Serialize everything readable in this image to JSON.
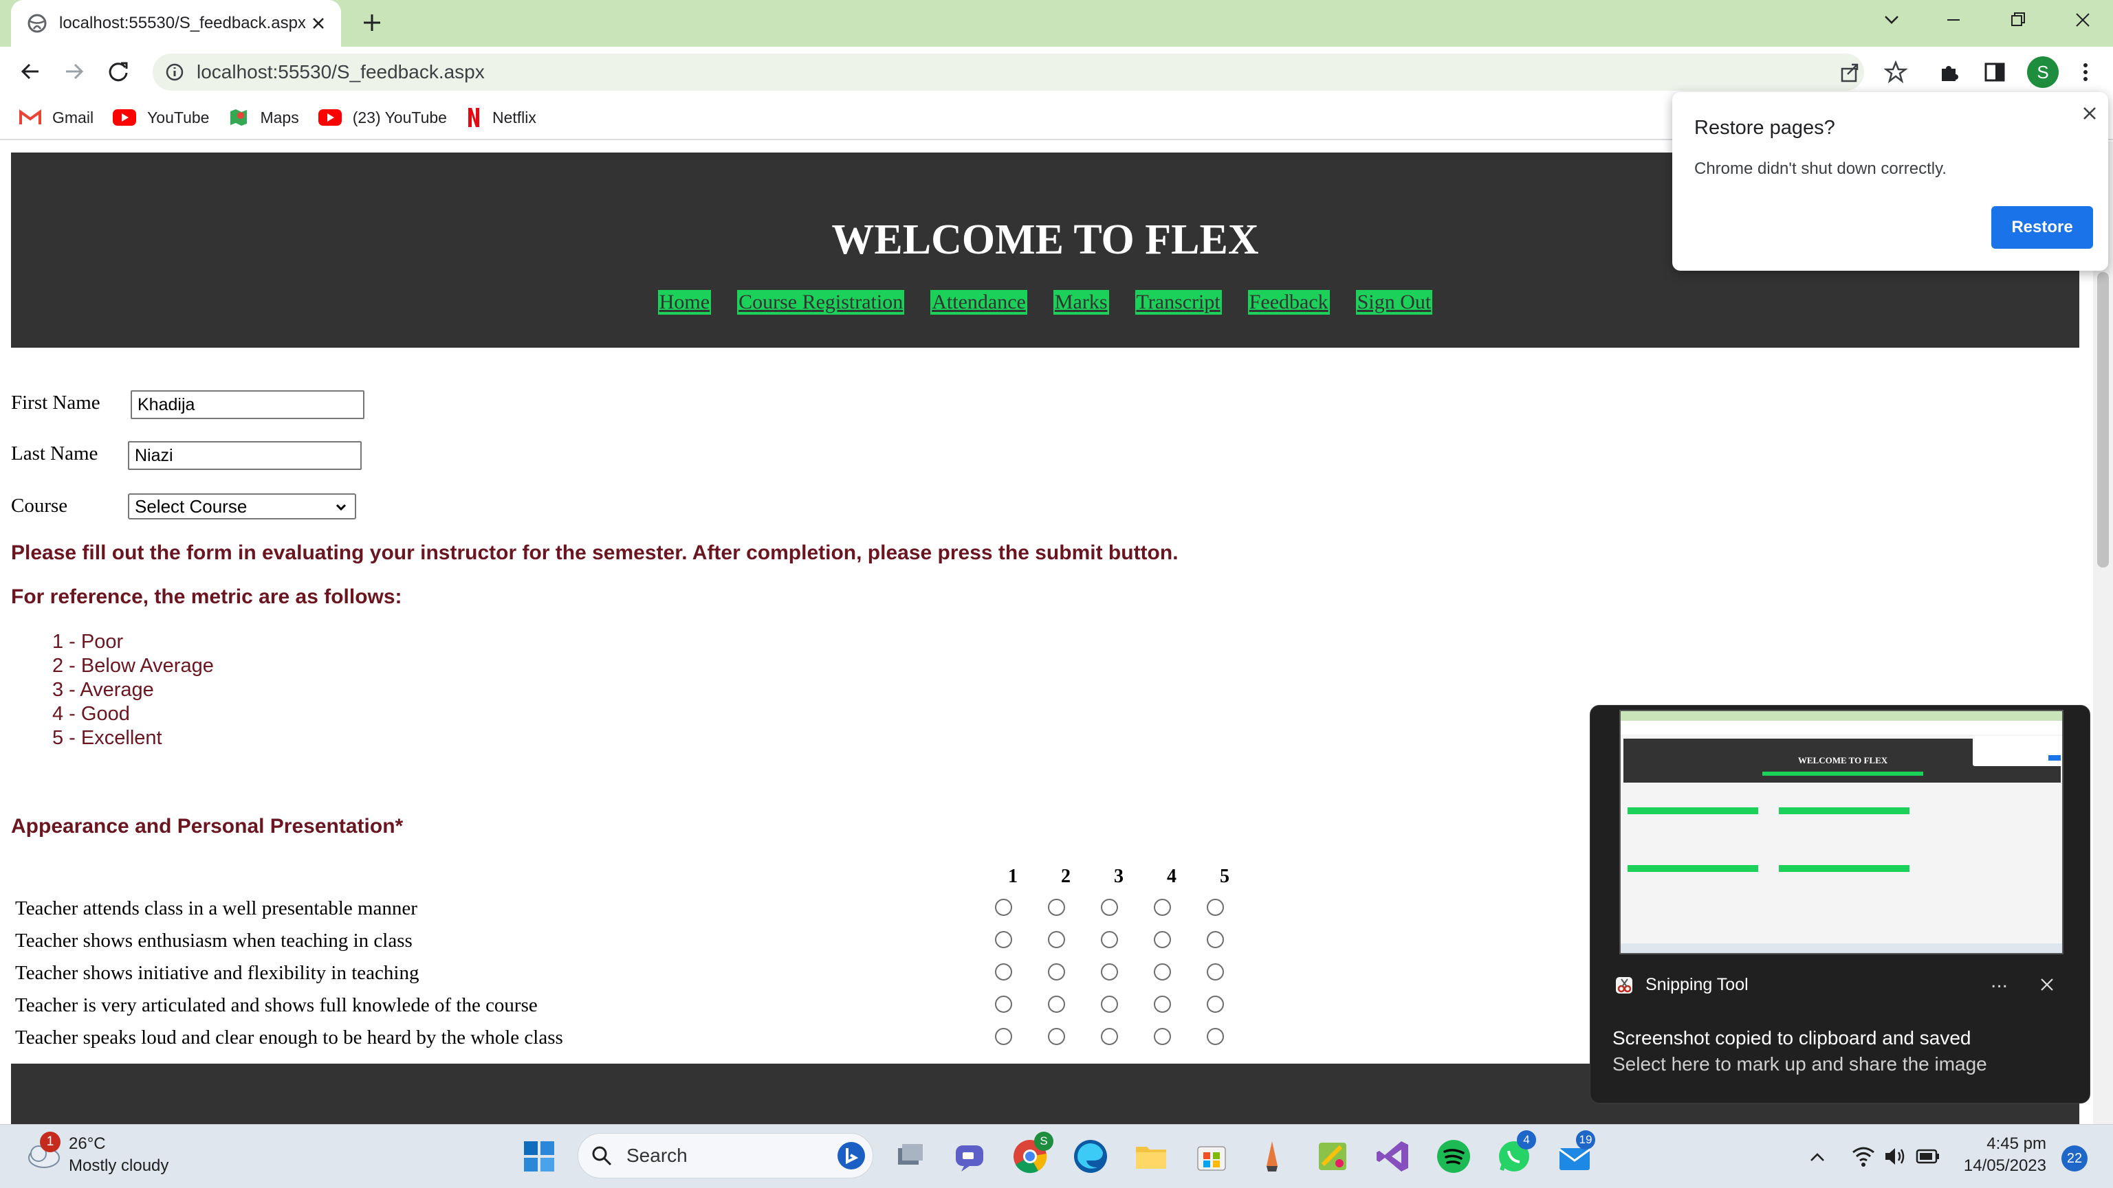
{
  "browser": {
    "tab_title": "localhost:55530/S_feedback.aspx",
    "url": "localhost:55530/S_feedback.aspx",
    "profile_initial": "S",
    "bookmarks": [
      {
        "label": "Gmail",
        "icon": "gmail-icon"
      },
      {
        "label": "YouTube",
        "icon": "youtube-icon"
      },
      {
        "label": "Maps",
        "icon": "maps-icon"
      },
      {
        "label": "(23) YouTube",
        "icon": "youtube-icon"
      },
      {
        "label": "Netflix",
        "icon": "netflix-icon"
      }
    ]
  },
  "site": {
    "title": "WELCOME TO FLEX",
    "nav": [
      "Home",
      "Course Registration",
      "Attendance",
      "Marks",
      "Transcript",
      "Feedback",
      "Sign Out"
    ],
    "colors": {
      "header": "#333333",
      "nav_bg": "#1bd15a",
      "instruction": "#6b1520"
    }
  },
  "form": {
    "first_name_label": "First Name",
    "first_name_value": "Khadija",
    "last_name_label": "Last Name",
    "last_name_value": "Niazi",
    "course_label": "Course",
    "course_selected": "Select Course",
    "instruction": "Please fill out the form in evaluating your instructor for the semester. After completion, please press the submit button.",
    "metric_heading": "For reference, the metric are as follows:",
    "metrics": [
      "1 - Poor",
      "2 - Below Average",
      "3 - Average",
      "4 - Good",
      "5 - Excellent"
    ],
    "section_title": "Appearance and Personal Presentation*",
    "scale": [
      "1",
      "2",
      "3",
      "4",
      "5"
    ],
    "questions": [
      "Teacher attends class in a well presentable manner",
      "Teacher shows enthusiasm when teaching in class",
      "Teacher shows initiative and flexibility in teaching",
      "Teacher is very articulated and shows full knowlede of the course",
      "Teacher speaks loud and clear enough to be heard by the whole class"
    ]
  },
  "restore_popup": {
    "title": "Restore pages?",
    "message": "Chrome didn't shut down correctly.",
    "button": "Restore"
  },
  "snipping_toast": {
    "app": "Snipping Tool",
    "more": "...",
    "line1": "Screenshot copied to clipboard and saved",
    "line2": "Select here to mark up and share the image",
    "thumb_title": "WELCOME TO FLEX"
  },
  "taskbar": {
    "weather_temp": "26°C",
    "weather_desc": "Mostly cloudy",
    "weather_badge": "1",
    "search_label": "Search",
    "chrome_badge": "S",
    "whatsapp_badge": "4",
    "mail_badge": "19",
    "time": "4:45 pm",
    "date": "14/05/2023",
    "notifications": "22"
  }
}
